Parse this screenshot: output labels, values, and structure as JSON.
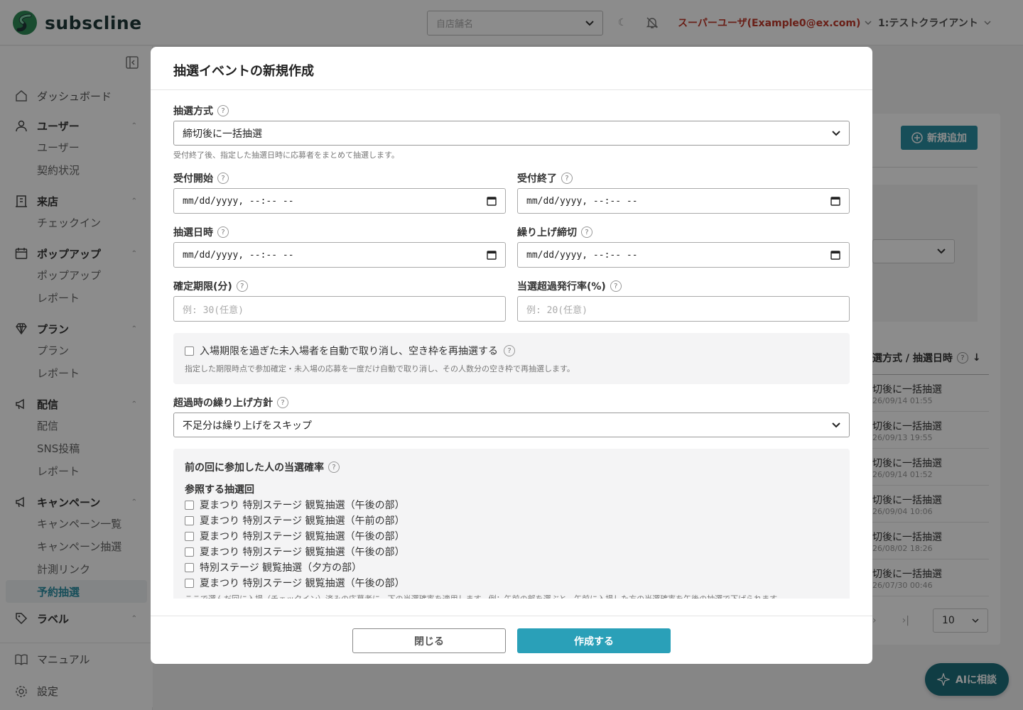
{
  "header": {
    "logo_text": "subscline",
    "store_placeholder": "自店舗名",
    "user_label": "スーパーユーザ(Example0@ex.com)",
    "client_label": "1:テストクライアント"
  },
  "sidebar": {
    "dashboard": "ダッシュボード",
    "groups": [
      {
        "label": "ユーザー",
        "items": [
          "ユーザー",
          "契約状況"
        ]
      },
      {
        "label": "来店",
        "items": [
          "チェックイン"
        ]
      },
      {
        "label": "ポップアップ",
        "items": [
          "ポップアップ",
          "レポート"
        ]
      },
      {
        "label": "プラン",
        "items": [
          "プラン",
          "レポート"
        ]
      },
      {
        "label": "配信",
        "items": [
          "配信",
          "SNS投稿",
          "レポート"
        ]
      },
      {
        "label": "キャンペーン",
        "items": [
          "キャンペーン一覧",
          "キャンペーン抽選",
          "計測リンク",
          "予約抽選"
        ]
      },
      {
        "label": "ラベル",
        "items": []
      }
    ],
    "manual": "マニュアル",
    "settings": "設定"
  },
  "background": {
    "add_button": "新規追加",
    "column_header": "選方式 / 抽選日時",
    "rows": [
      {
        "method": "切後に一括抽選",
        "date": "26/09/14 01:55"
      },
      {
        "method": "切後に一括抽選",
        "date": "26/09/13 19:55"
      },
      {
        "method": "切後に一括抽選",
        "date": "26/09/14 01:52"
      },
      {
        "method": "切後に一括抽選",
        "date": "26/09/04 10:06"
      },
      {
        "method": "切後に一括抽選",
        "date": "26/08/02 18:26"
      },
      {
        "method": "切後に一括抽選",
        "date": "26/07/30 00:46"
      }
    ],
    "page_size": "10",
    "ai_button": "AIに相談"
  },
  "modal": {
    "title": "抽選イベントの新規作成",
    "method_label": "抽選方式",
    "method_value": "締切後に一括抽選",
    "method_hint": "受付終了後、指定した抽選日時に応募者をまとめて抽選します。",
    "accept_start_label": "受付開始",
    "accept_end_label": "受付終了",
    "draw_date_label": "抽選日時",
    "carry_deadline_label": "繰り上げ締切",
    "datetime_placeholder": "mm/dd/yyyy, --:-- --",
    "confirm_limit_label": "確定期限(分)",
    "confirm_limit_placeholder": "例: 30(任意)",
    "over_rate_label": "当選超過発行率(%)",
    "over_rate_placeholder": "例: 20(任意)",
    "auto_cancel_label": "入場期限を過ぎた未入場者を自動で取り消し、空き枠を再抽選する",
    "auto_cancel_hint": "指定した期限時点で参加確定・未入場の応募を一度だけ自動で取り消し、その人数分の空き枠で再抽選します。",
    "carry_policy_label": "超過時の繰り上げ方針",
    "carry_policy_value": "不足分は繰り上げをスキップ",
    "prev_rate_label": "前の回に参加した人の当選確率",
    "ref_rounds_label": "参照する抽選回",
    "ref_rounds": [
      "夏まつり 特別ステージ 観覧抽選（午後の部）",
      "夏まつり 特別ステージ 観覧抽選（午前の部）",
      "夏まつり 特別ステージ 観覧抽選（午後の部）",
      "夏まつり 特別ステージ 観覧抽選（午後の部）",
      "特別ステージ 観覧抽選（夕方の部）",
      "夏まつり 特別ステージ 観覧抽選（午後の部）"
    ],
    "ref_hint": "ここで選んだ回に入場（チェックイン）済みの応募者に、下の当選確率を適用します。例：午前の部を選ぶと、午前に入場した方の当選確率を午後の抽選で下げられます。",
    "close_button": "閉じる",
    "create_button": "作成する"
  },
  "colors": {
    "accent": "#2aa0b8",
    "user": "#c0392b",
    "brand": "#1f3a3a"
  }
}
